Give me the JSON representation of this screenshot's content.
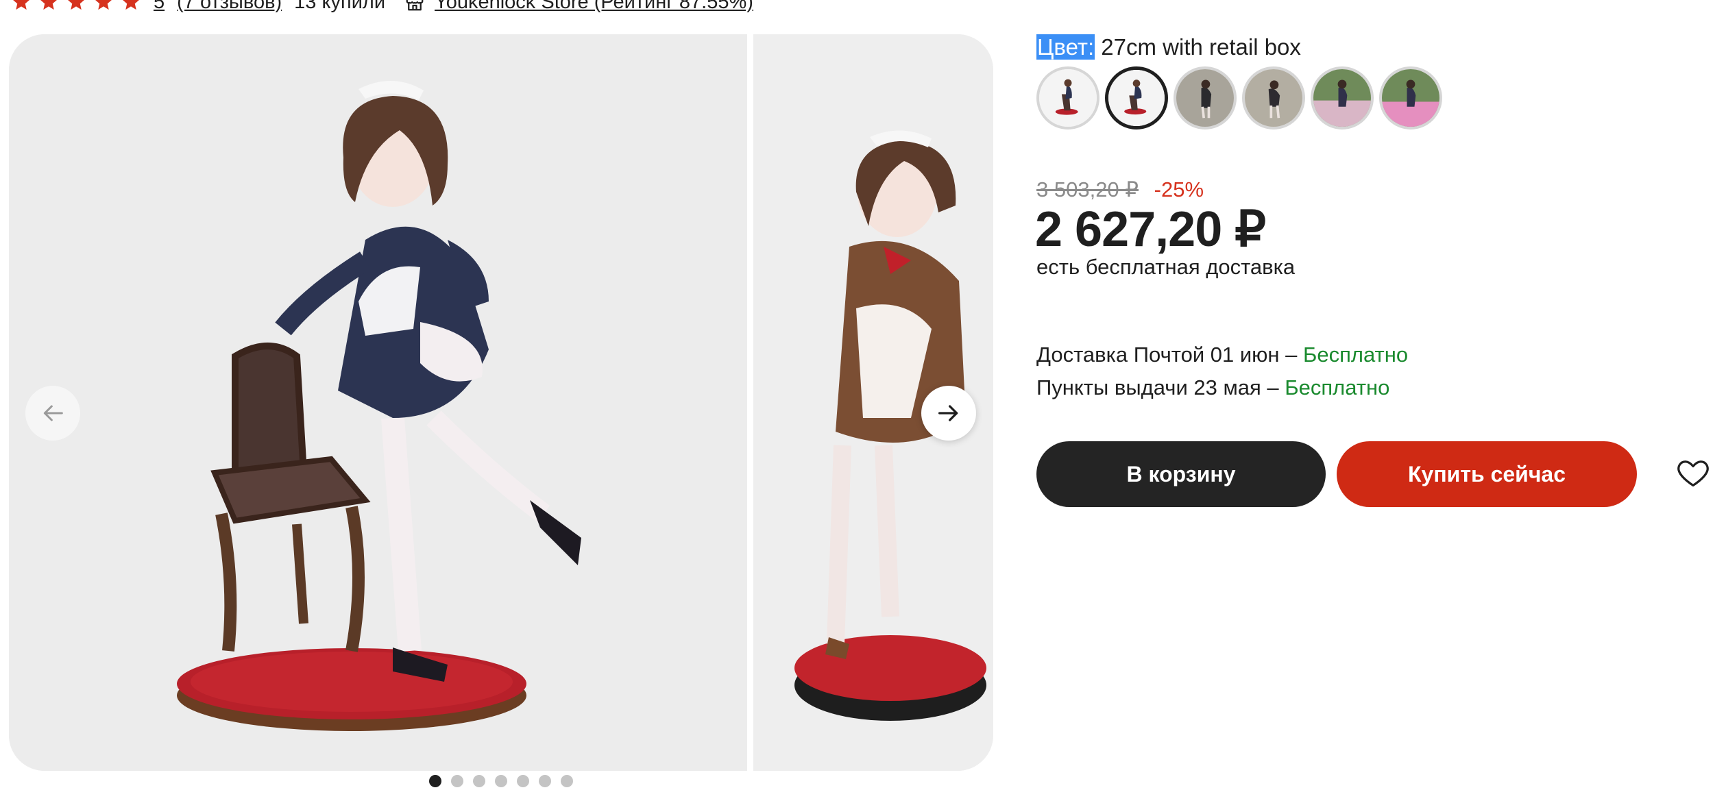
{
  "rating": {
    "stars_filled": 5,
    "score": "5",
    "reviews_link": "(7 отзывов)",
    "purchases": "13 купили",
    "store_link": "Youkenlock Store (Рейтинг 87.55%)"
  },
  "gallery": {
    "slide_count": 7,
    "active_index": 0
  },
  "product": {
    "color_label": "Цвет:",
    "color_value": "27cm with retail box",
    "selected_swatch": 1,
    "swatch_count": 6
  },
  "pricing": {
    "old_price": "3 503,20 ₽",
    "discount": "-25%",
    "price": "2 627,20 ₽",
    "free_delivery": "есть бесплатная доставка"
  },
  "delivery": {
    "mail_label": "Доставка Почтой 01 июн –",
    "mail_cost": "Бесплатно",
    "pickup_label": "Пункты выдачи 23 мая –",
    "pickup_cost": "Бесплатно"
  },
  "actions": {
    "cart_label": "В корзину",
    "buy_label": "Купить сейчас"
  },
  "colors": {
    "accent_red": "#cf2a14",
    "dark_button": "#242424",
    "green": "#1a8a2e",
    "highlight": "#3b8ff6"
  },
  "icons": {
    "star": "star-icon",
    "store": "store-icon",
    "prev": "arrow-left-icon",
    "next": "arrow-right-icon",
    "favorite": "heart-icon"
  }
}
